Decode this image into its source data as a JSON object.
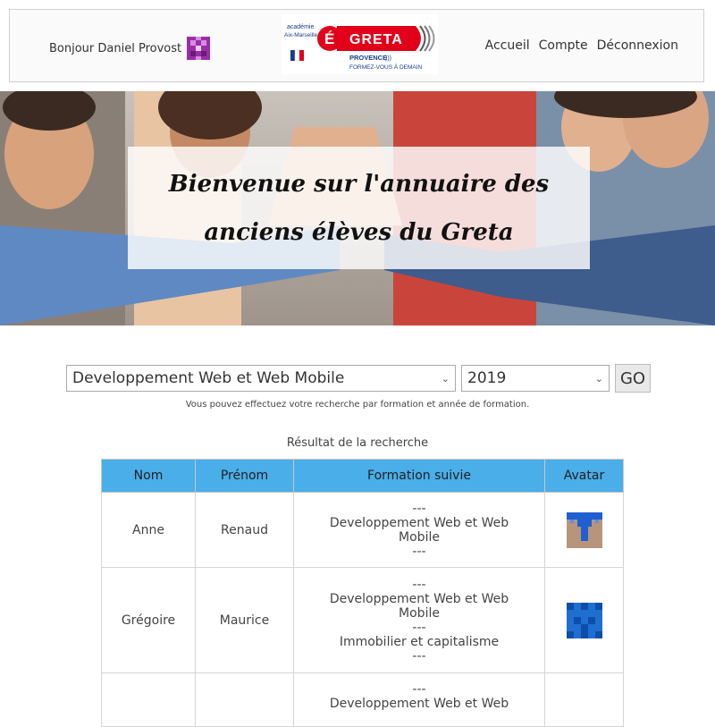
{
  "header": {
    "greeting": "Bonjour Daniel Provost",
    "logo": {
      "academie_line1": "académie",
      "academie_line2": "Aix-Marseille",
      "brand": "GRETA",
      "region": "PROVENCE",
      "slogan": "FORMEZ-VOUS À DEMAIN"
    },
    "nav": [
      {
        "label": "Accueil"
      },
      {
        "label": "Compte"
      },
      {
        "label": "Déconnexion"
      }
    ]
  },
  "hero": {
    "title": "Bienvenue sur l'annuaire des anciens élèves du Greta"
  },
  "search": {
    "formation_selected": "Developpement Web et Web Mobile",
    "year_selected": "2019",
    "go_label": "GO",
    "hint": "Vous pouvez effectuez votre recherche par formation et année de formation."
  },
  "results": {
    "title": "Résultat de la recherche",
    "headers": [
      "Nom",
      "Prénom",
      "Formation suivie",
      "Avatar"
    ],
    "rows": [
      {
        "nom": "Anne",
        "prenom": "Renaud",
        "formations": [
          "---",
          "Developpement Web et Web",
          "Mobile",
          "---"
        ],
        "avatar": "avatar-blue-tan-icon"
      },
      {
        "nom": "Grégoire",
        "prenom": "Maurice",
        "formations": [
          "---",
          "Developpement Web et Web",
          "Mobile",
          "---",
          "Immobilier et capitalisme",
          "---"
        ],
        "avatar": "avatar-blue-pattern-icon"
      },
      {
        "nom": "",
        "prenom": "",
        "formations": [
          "---",
          "Developpement Web et Web"
        ],
        "avatar": ""
      }
    ]
  },
  "colors": {
    "table_header": "#4aaee8",
    "logo_red": "#e2001a",
    "logo_blue": "#1a3a8a"
  }
}
